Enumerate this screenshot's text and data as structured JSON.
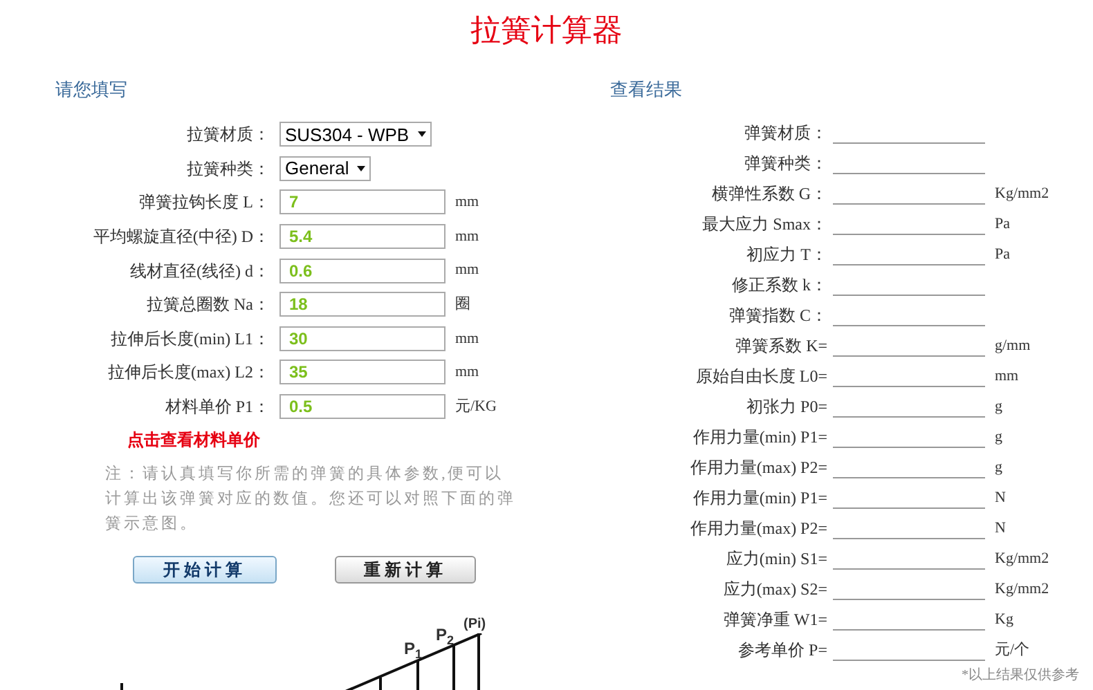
{
  "title": "拉簧计算器",
  "input_section": {
    "heading": "请您填写",
    "fields": [
      {
        "kind": "select",
        "label": "拉簧材质：",
        "value": "SUS304 - WPB"
      },
      {
        "kind": "select",
        "label": "拉簧种类：",
        "value": "General"
      },
      {
        "kind": "text",
        "label": "弹簧拉钩长度 L：",
        "value": "7",
        "unit": "mm"
      },
      {
        "kind": "text",
        "label": "平均螺旋直径(中径) D：",
        "value": "5.4",
        "unit": "mm"
      },
      {
        "kind": "text",
        "label": "线材直径(线径) d：",
        "value": "0.6",
        "unit": "mm"
      },
      {
        "kind": "text",
        "label": "拉簧总圈数 Na：",
        "value": "18",
        "unit": "圈"
      },
      {
        "kind": "text",
        "label": "拉伸后长度(min) L1：",
        "value": "30",
        "unit": "mm"
      },
      {
        "kind": "text",
        "label": "拉伸后长度(max) L2：",
        "value": "35",
        "unit": "mm"
      },
      {
        "kind": "text",
        "label": "材料单价 P1：",
        "value": "0.5",
        "unit": "元/KG"
      }
    ],
    "price_link": "点击查看材料单价",
    "note": "注：请认真填写你所需的弹簧的具体参数,便可以计算出该弹簧对应的数值。您还可以对照下面的弹簧示意图。",
    "buttons": [
      {
        "label": "开始计算",
        "kind": "primary"
      },
      {
        "label": "重新计算",
        "kind": "secondary"
      }
    ]
  },
  "diagram": {
    "labels": [
      "P$_{1}$",
      "P$_{2}$",
      "(Pi)"
    ]
  },
  "result_section": {
    "heading": "查看结果",
    "fields": [
      {
        "label": "弹簧材质："
      },
      {
        "label": "弹簧种类："
      },
      {
        "label": "横弹性系数 G：",
        "unit": "Kg/mm2"
      },
      {
        "label": "最大应力 Smax：",
        "unit": "Pa"
      },
      {
        "label": "初应力 T：",
        "unit": "Pa"
      },
      {
        "label": "修正系数 k："
      },
      {
        "label": "弹簧指数 C："
      },
      {
        "label": "弹簧系数 K=",
        "unit": "g/mm"
      },
      {
        "label": "原始自由长度 L0=",
        "unit": "mm"
      },
      {
        "label": "初张力 P0=",
        "unit": "g"
      },
      {
        "label": "作用力量(min) P1=",
        "unit": "g"
      },
      {
        "label": "作用力量(max) P2=",
        "unit": "g"
      },
      {
        "label": "作用力量(min) P1=",
        "unit": "N"
      },
      {
        "label": "作用力量(max) P2=",
        "unit": "N"
      },
      {
        "label": "应力(min) S1=",
        "unit": "Kg/mm2"
      },
      {
        "label": "应力(max) S2=",
        "unit": "Kg/mm2"
      },
      {
        "label": "弹簧净重 W1=",
        "unit": "Kg"
      },
      {
        "label": "参考单价 P=",
        "unit": "元/个"
      }
    ],
    "footnote": "*以上结果仅供参考"
  }
}
